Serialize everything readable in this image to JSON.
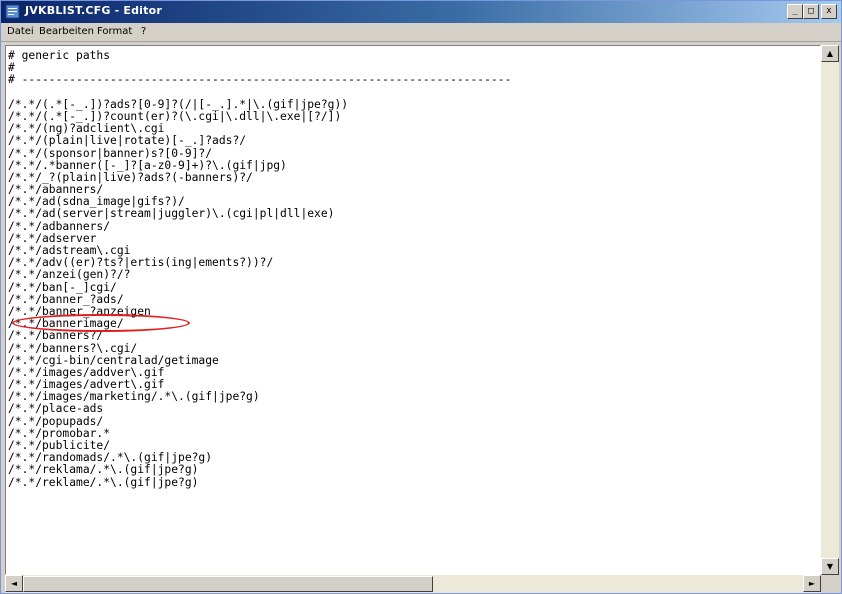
{
  "window": {
    "title": "JVKBLIST.CFG - Editor",
    "minimize": "_",
    "maximize": "□",
    "close": "x"
  },
  "menu": {
    "items": [
      {
        "label": "Datei"
      },
      {
        "label": "Bearbeiten"
      },
      {
        "label": "Format"
      },
      {
        "label": "?"
      }
    ]
  },
  "editor": {
    "lines": [
      "# generic paths",
      "#",
      "# ------------------------------------------------------------------------",
      "",
      "/*.*/(.*[-_.])?ads?[0-9]?(/|[-_.].*|\\.(gif|jpe?g))",
      "/*.*/(.*[-_.])?count(er)?(\\.cgi|\\.dll|\\.exe|[?/])",
      "/*.*/(ng)?adclient\\.cgi",
      "/*.*/(plain|live|rotate)[-_.]?ads?/",
      "/*.*/(sponsor|banner)s?[0-9]?/",
      "/*.*/.*banner([-_]?[a-z0-9]+)?\\.(gif|jpg)",
      "/*.*/_?(plain|live)?ads?(-banners)?/",
      "/*.*/abanners/",
      "/*.*/ad(sdna_image|gifs?)/",
      "/*.*/ad(server|stream|juggler)\\.(cgi|pl|dll|exe)",
      "/*.*/adbanners/",
      "/*.*/adserver",
      "/*.*/adstream\\.cgi",
      "/*.*/adv((er)?ts?|ertis(ing|ements?))?/",
      "/*.*/anzei(gen)?/?",
      "/*.*/ban[-_]cgi/",
      "/*.*/banner_?ads/",
      "/*.*/banner_?anzeigen",
      "/*.*/bannerimage/",
      "/*.*/banners?/",
      "/*.*/banners?\\.cgi/",
      "/*.*/cgi-bin/centralad/getimage",
      "/*.*/images/addver\\.gif",
      "/*.*/images/advert\\.gif",
      "/*.*/images/marketing/.*\\.(gif|jpe?g)",
      "/*.*/place-ads",
      "/*.*/popupads/",
      "/*.*/promobar.*",
      "/*.*/publicite/",
      "/*.*/randomads/.*\\.(gif|jpe?g)",
      "/*.*/reklama/.*\\.(gif|jpe?g)",
      "/*.*/reklame/.*\\.(gif|jpe?g)"
    ]
  },
  "scroll": {
    "up": "▲",
    "down": "▼",
    "left": "◄",
    "right": "►"
  },
  "colors": {
    "title_gradient_start": "#0a246a",
    "title_gradient_end": "#a6caf0",
    "highlight": "#e02020"
  }
}
